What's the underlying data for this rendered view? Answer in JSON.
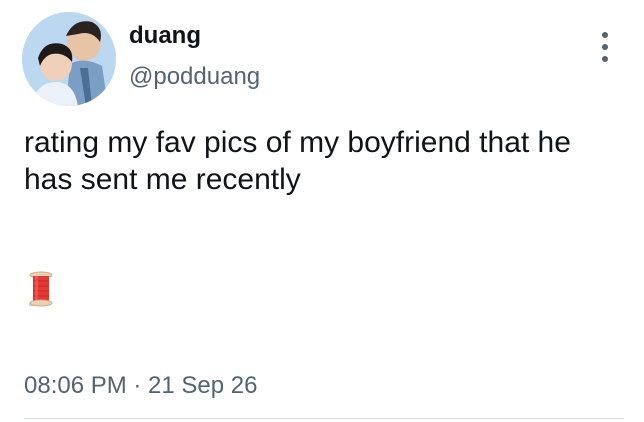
{
  "user": {
    "display_name": "duang",
    "handle": "@podduang"
  },
  "tweet": {
    "text": "rating my fav pics of my boyfriend that he has sent me recently",
    "emoji_icon": "spool-of-thread-icon",
    "timestamp": "08:06 PM · 21 Sep 26"
  },
  "colors": {
    "text_primary": "#0f1419",
    "text_secondary": "#536471",
    "divider": "#cfd9de"
  }
}
